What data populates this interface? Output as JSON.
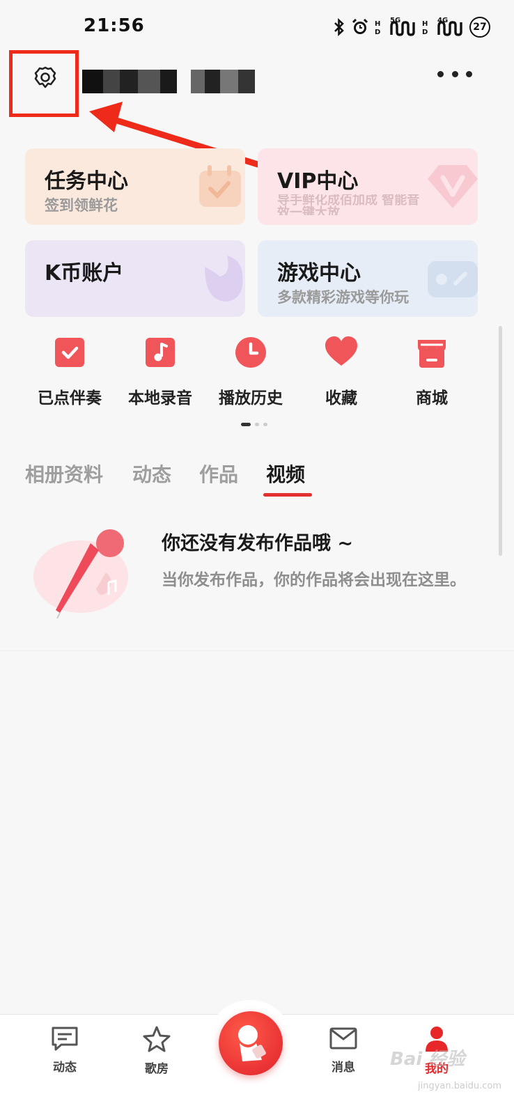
{
  "status_bar": {
    "time": "21:56",
    "icons": [
      "bluetooth-icon",
      "alarm-icon",
      "hd-icon",
      "signal-5g-icon",
      "hd-icon",
      "signal-4g-icon"
    ],
    "network_5g": "5G",
    "network_4g": "4G",
    "battery": "27"
  },
  "header": {
    "settings_icon": "gear-icon",
    "more_icon": "more-dots-icon"
  },
  "cards": [
    {
      "title": "任务中心",
      "subtitle": "签到领鲜花",
      "bg": "#fbe9de",
      "icon": "calendar-check-icon"
    },
    {
      "title": "VIP中心",
      "subtitle": "导手鲜化成佰加成 智能音效一键大放",
      "bg": "#fde4e8",
      "icon": "diamond-v-icon"
    },
    {
      "title": "K币账户",
      "subtitle": "",
      "bg": "#ece5f6",
      "icon": "leaf-icon"
    },
    {
      "title": "游戏中心",
      "subtitle": "多款精彩游戏等你玩",
      "bg": "#e7edf6",
      "icon": "gamepad-icon"
    }
  ],
  "shortcuts": [
    {
      "label": "已点伴奏",
      "icon": "checkbox-icon"
    },
    {
      "label": "本地录音",
      "icon": "music-note-icon"
    },
    {
      "label": "播放历史",
      "icon": "clock-icon"
    },
    {
      "label": "收藏",
      "icon": "heart-icon"
    },
    {
      "label": "商城",
      "icon": "shop-icon"
    }
  ],
  "tabs": [
    {
      "label": "相册资料",
      "active": false
    },
    {
      "label": "动态",
      "active": false
    },
    {
      "label": "作品",
      "active": false
    },
    {
      "label": "视频",
      "active": true
    }
  ],
  "empty_state": {
    "title": "你还没有发布作品哦 ~",
    "description": "当你发布作品，你的作品将会出现在这里。",
    "illustration": "microphone-icon"
  },
  "bottom_nav": [
    {
      "label": "动态",
      "icon": "chat-icon",
      "active": false
    },
    {
      "label": "歌房",
      "icon": "star-icon",
      "active": false
    },
    {
      "label": "",
      "icon": "sing-button-icon",
      "active": false
    },
    {
      "label": "消息",
      "icon": "mail-icon",
      "active": false
    },
    {
      "label": "我的",
      "icon": "profile-icon",
      "active": true
    }
  ],
  "watermark": {
    "brand": "Bai 经验",
    "url": "jingyan.baidu.com"
  },
  "colors": {
    "accent": "#e8272a",
    "highlight": "#ee2a1b",
    "icon_red": "#f0555a"
  }
}
